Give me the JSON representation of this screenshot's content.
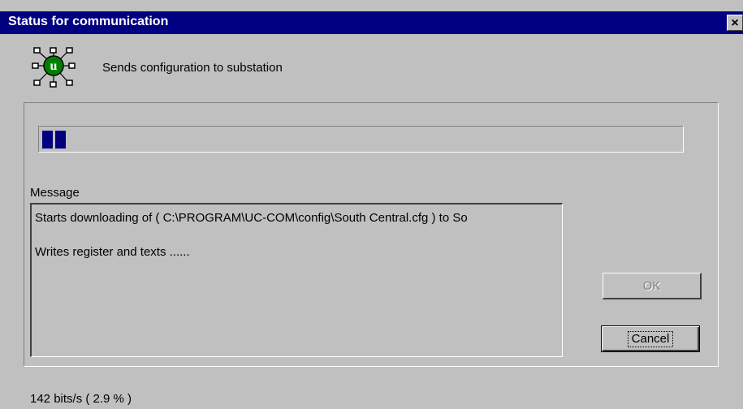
{
  "window": {
    "title": "Status for communication",
    "close_glyph": "×"
  },
  "header": {
    "icon": "uc-com-network-icon",
    "icon_letter": "u",
    "text": "Sends configuration to substation"
  },
  "progress": {
    "fraction": 0.029,
    "segments_filled": 2,
    "fill_color": "#000080"
  },
  "message": {
    "label": "Message",
    "lines": [
      "Starts downloading of ( C:\\PROGRAM\\UC-COM\\config\\South Central.cfg ) to So",
      "Writes register and  texts ......"
    ]
  },
  "buttons": {
    "ok": "OK",
    "cancel": "Cancel"
  },
  "status": {
    "text": "142 bits/s (   2.9 % )"
  }
}
